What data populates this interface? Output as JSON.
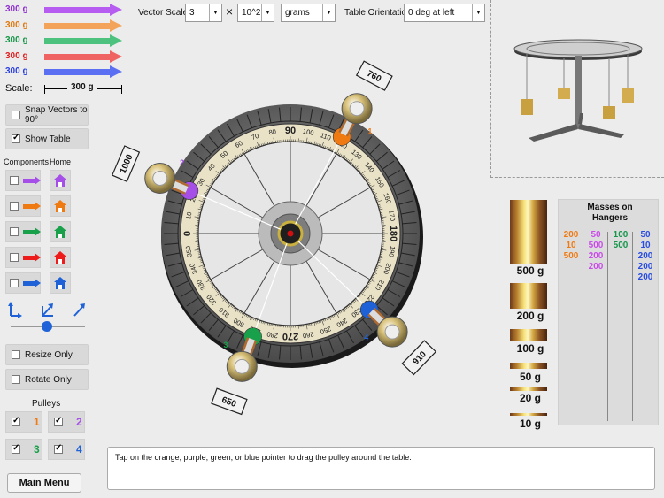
{
  "left_panel": {
    "vector_arrows": [
      {
        "mass": "300 g",
        "color": "#b65cf0"
      },
      {
        "mass": "300 g",
        "color": "#f3a35a"
      },
      {
        "mass": "300 g",
        "color": "#4cc27e"
      },
      {
        "mass": "300 g",
        "color": "#f06363"
      },
      {
        "mass": "300 g",
        "color": "#5b6ff2"
      }
    ],
    "mass_colors": [
      "#8e2fd0",
      "#e07a10",
      "#16964a",
      "#e02020",
      "#2a3fe0"
    ],
    "scale_label": "Scale:",
    "scale_value": "300 g",
    "snap_label": "Snap Vectors to 90°",
    "show_table_label": "Show Table",
    "components_label": "Components",
    "home_label": "Home",
    "component_colors": [
      "#a64fe8",
      "#f07a12",
      "#18a04a",
      "#ee1b1b",
      "#1f62d8"
    ],
    "resize_label": "Resize Only",
    "rotate_label": "Rotate Only",
    "pulleys_label": "Pulleys",
    "pulleys": [
      {
        "num": "1",
        "color": "#f07a12"
      },
      {
        "num": "2",
        "color": "#a64fe8"
      },
      {
        "num": "3",
        "color": "#18a04a"
      },
      {
        "num": "4",
        "color": "#1f62d8"
      }
    ],
    "main_menu_label": "Main Menu"
  },
  "top_bar": {
    "vector_scale_label": "Vector Scale:",
    "scale_select": "3",
    "times": "×",
    "power_select": "10^2",
    "unit_select": "grams",
    "orientation_label": "Table Orientation:",
    "orientation_select": "0 deg at left"
  },
  "table": {
    "major_labels": {
      "top": "270",
      "bottom": "90",
      "left": "0",
      "right": "180"
    },
    "pulleys": [
      {
        "num": "1",
        "mass": "760",
        "angle_deg": 118,
        "color": "#f07a12"
      },
      {
        "num": "2",
        "mass": "1000",
        "angle_deg": 23,
        "color": "#a64fe8"
      },
      {
        "num": "3",
        "mass": "650",
        "angle_deg": 290,
        "color": "#18a04a"
      },
      {
        "num": "4",
        "mass": "910",
        "angle_deg": 224,
        "color": "#1f62d8"
      }
    ]
  },
  "masses": {
    "blocks": [
      "500 g",
      "200 g",
      "100 g",
      "50 g",
      "20 g",
      "10 g"
    ],
    "hangers_title": "Masses on Hangers",
    "columns": [
      {
        "color": "#f07a12",
        "values": [
          "200",
          "10",
          "500"
        ]
      },
      {
        "color": "#c94be8",
        "values": [
          "50",
          "500",
          "200",
          "200"
        ]
      },
      {
        "color": "#16964a",
        "values": [
          "100",
          "500"
        ]
      },
      {
        "color": "#2a4de0",
        "values": [
          "50",
          "10",
          "200",
          "200",
          "200"
        ]
      }
    ]
  },
  "message": "Tap on the orange, purple, green, or blue pointer to drag the pulley around the table."
}
